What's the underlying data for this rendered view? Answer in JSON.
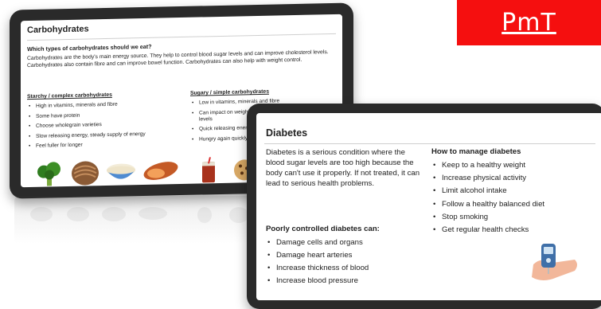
{
  "brand": {
    "label": "PmT",
    "color": "#f50f0f"
  },
  "carbohydrates": {
    "title": "Carbohydrates",
    "question": "Which types of carbohydrates should we eat?",
    "intro": "Carbohydrates are the body's main energy source. They help to control blood sugar levels and can improve cholesterol levels. Carbohydrates also contain fibre and can improve bowel function. Carbohydrates can also help with weight control.",
    "starchy": {
      "heading": "Starchy / complex carbohydrates",
      "items": [
        "High in vitamins, minerals and fibre",
        "Some have protein",
        "Choose wholegrain varieties",
        "Slow releasing energy, steady supply of energy",
        "Feel fuller for longer"
      ]
    },
    "sugary": {
      "heading": "Sugary / simple carbohydrates",
      "items": [
        "Low in vitamins, minerals and fibre",
        "Can impact on weight, dental health and blood sugar levels",
        "Quick releasing ener",
        "Hungry again quickly"
      ]
    },
    "foods": [
      "broccoli-icon",
      "wholegrain-pasta-icon",
      "rice-bowl-icon",
      "sweet-potato-icon",
      "fizzy-drink-icon",
      "cookie-icon"
    ]
  },
  "diabetes": {
    "title": "Diabetes",
    "intro": "Diabetes is a serious condition where the blood sugar levels are too high because the body can't use it properly. If not treated, it can lead to serious health problems.",
    "poorly": {
      "heading": "Poorly controlled diabetes can:",
      "items": [
        "Damage cells and organs",
        "Damage heart arteries",
        "Increase thickness of blood",
        "Increase blood pressure"
      ]
    },
    "manage": {
      "heading": "How to manage diabetes",
      "items": [
        "Keep to a healthy weight",
        "Increase physical activity",
        "Limit alcohol intake",
        "Follow a healthy balanced diet",
        "Stop smoking",
        "Get regular health checks"
      ]
    },
    "illustration": "glucose-meter-icon"
  }
}
